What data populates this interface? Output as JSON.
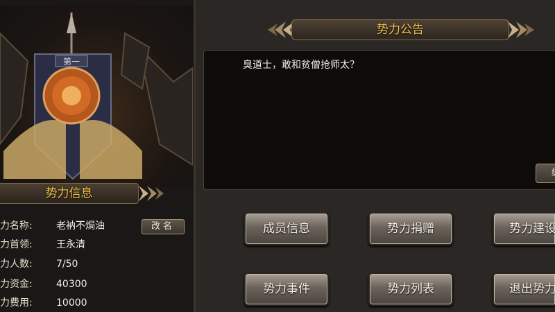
{
  "guild_info": {
    "title": "势力信息",
    "rows": [
      {
        "label": "力名称:",
        "value": "老衲不焗油"
      },
      {
        "label": "力首领:",
        "value": "王永清"
      },
      {
        "label": "力人数:",
        "value": "7/50"
      },
      {
        "label": "力资金:",
        "value": "40300"
      },
      {
        "label": "力费用:",
        "value": "10000"
      }
    ],
    "rename_label": "改名",
    "banner_text": "第一"
  },
  "notice": {
    "title": "势力公告",
    "text": "臭道士，敢和贫僧抢师太？",
    "edit_label": "编"
  },
  "actions": [
    {
      "label": "成员信息"
    },
    {
      "label": "势力捐赠"
    },
    {
      "label": "势力建设"
    },
    {
      "label": "势力事件"
    },
    {
      "label": "势力列表"
    },
    {
      "label": "退出势力"
    }
  ],
  "colors": {
    "title_gold": "#f2c14a",
    "panel_dark": "#1a1816",
    "panel": "#2b2724"
  }
}
